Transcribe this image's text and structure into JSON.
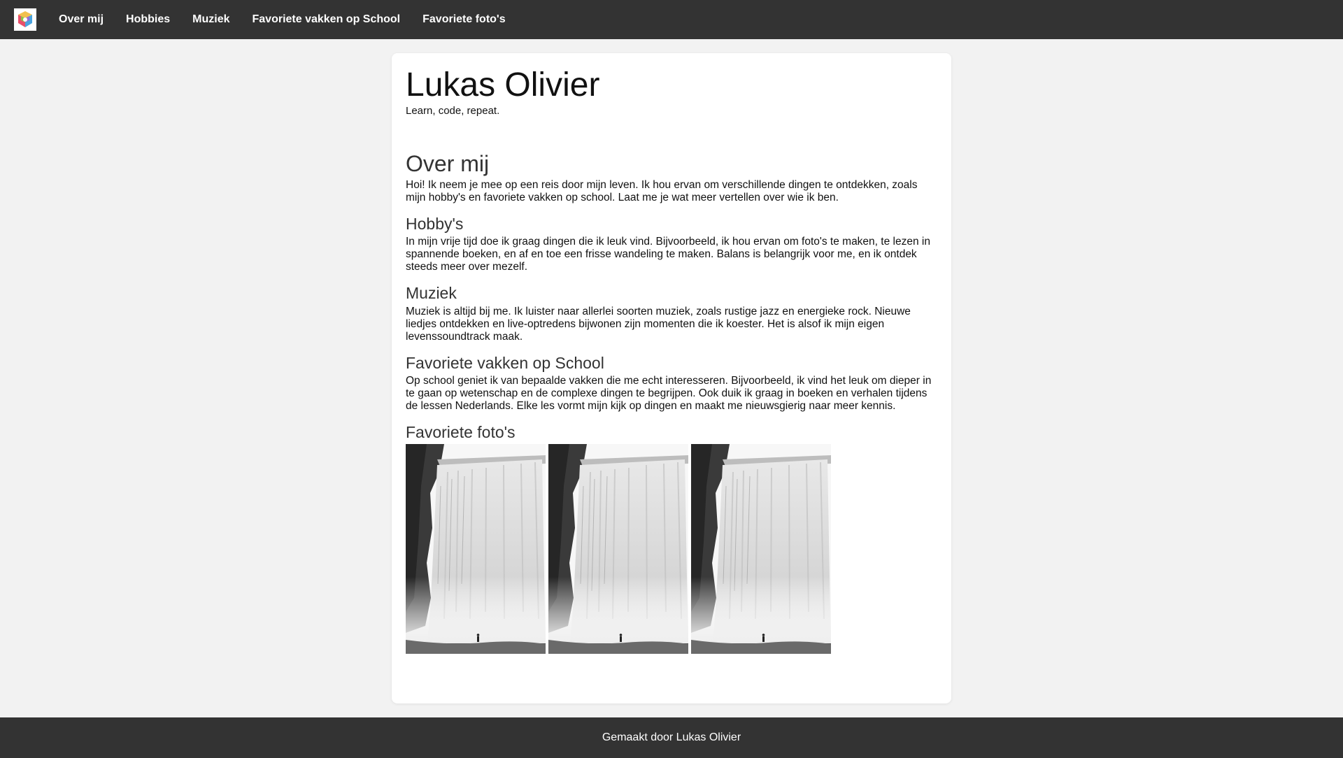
{
  "nav": {
    "logo_icon": "colorful-cube-logo-icon",
    "links": [
      "Over mij",
      "Hobbies",
      "Muziek",
      "Favoriete vakken op School",
      "Favoriete foto's"
    ]
  },
  "header": {
    "title": "Lukas Olivier",
    "tagline": "Learn, code, repeat."
  },
  "sections": {
    "about": {
      "heading": "Over mij",
      "text": "Hoi! Ik neem je mee op een reis door mijn leven. Ik hou ervan om verschillende dingen te ontdekken, zoals mijn hobby's en favoriete vakken op school. Laat me je wat meer vertellen over wie ik ben."
    },
    "hobbies": {
      "heading": "Hobby's",
      "text": "In mijn vrije tijd doe ik graag dingen die ik leuk vind. Bijvoorbeeld, ik hou ervan om foto's te maken, te lezen in spannende boeken, en af en toe een frisse wandeling te maken. Balans is belangrijk voor me, en ik ontdek steeds meer over mezelf."
    },
    "music": {
      "heading": "Muziek",
      "text": "Muziek is altijd bij me. Ik luister naar allerlei soorten muziek, zoals rustige jazz en energieke rock. Nieuwe liedjes ontdekken en live-optredens bijwonen zijn momenten die ik koester. Het is alsof ik mijn eigen levenssoundtrack maak."
    },
    "school": {
      "heading": "Favoriete vakken op School",
      "text": "Op school geniet ik van bepaalde vakken die me echt interesseren. Bijvoorbeeld, ik vind het leuk om dieper in te gaan op wetenschap en de complexe dingen te begrijpen. Ook duik ik graag in boeken en verhalen tijdens de lessen Nederlands. Elke les vormt mijn kijk op dingen en maakt me nieuwsgierig naar meer kennis."
    },
    "photos": {
      "heading": "Favoriete foto's",
      "count": 3,
      "image_subject": "waterfall-photo"
    }
  },
  "footer": {
    "text": "Gemaakt door Lukas Olivier"
  },
  "colors": {
    "navbar_bg": "#333333",
    "page_bg": "#f2f2f2",
    "card_bg": "#ffffff"
  }
}
